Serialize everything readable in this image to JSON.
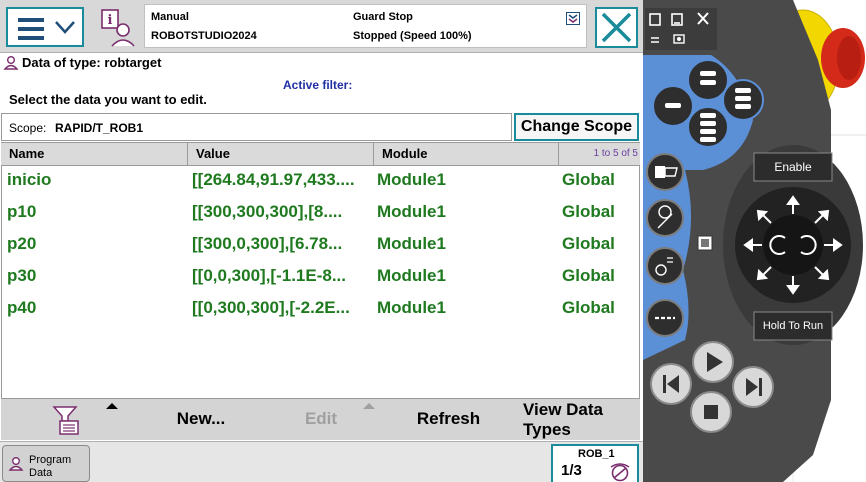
{
  "topbar": {
    "mode": "Manual",
    "controller": "ROBOTSTUDIO2024",
    "guard": "Guard Stop",
    "state": "Stopped (Speed 100%)"
  },
  "page": {
    "title": "Data of type: robtarget",
    "filter_label": "Active filter:",
    "instruction": "Select the data you want to edit.",
    "scope_label": "Scope:",
    "scope_value": "RAPID/T_ROB1",
    "change_scope": "Change Scope"
  },
  "table": {
    "headers": [
      "Name",
      "Value",
      "Module"
    ],
    "range": "1 to 5 of 5",
    "rows": [
      {
        "name": "inicio",
        "value": "[[264.84,91.97,433....",
        "module": "Module1",
        "scope": "Global"
      },
      {
        "name": "p10",
        "value": "[[300,300,300],[8....",
        "module": "Module1",
        "scope": "Global"
      },
      {
        "name": "p20",
        "value": "[[300,0,300],[6.78...",
        "module": "Module1",
        "scope": "Global"
      },
      {
        "name": "p30",
        "value": "[[0,0,300],[-1.1E-8...",
        "module": "Module1",
        "scope": "Global"
      },
      {
        "name": "p40",
        "value": "[[0,300,300],[-2.2E...",
        "module": "Module1",
        "scope": "Global"
      }
    ]
  },
  "toolbar": {
    "new_label": "New...",
    "edit_label": "Edit",
    "refresh_label": "Refresh",
    "view_line1": "View Data",
    "view_line2": "Types"
  },
  "taskbar": {
    "program_data_line1": "Program",
    "program_data_line2": "Data",
    "rob_label": "ROB_1",
    "rob_fraction": "1/3"
  },
  "pendant": {
    "enable_label": "Enable",
    "hold_label": "Hold To Run"
  },
  "colors": {
    "accent": "#1a8b9a",
    "data_text": "#1f7a1f",
    "filter_text": "#1f2ea3",
    "pendant_body": "#4a4a4a",
    "pendant_blue": "#5b8fd6",
    "emergency_red": "#d42a1a",
    "emergency_yellow": "#f2d800"
  },
  "icons": [
    "menu-icon",
    "chevron-down-icon",
    "operator-info-icon",
    "close-icon",
    "robtarget-icon",
    "program-data-icon",
    "filter-icon",
    "mechanical-unit-icon",
    "increment-icon"
  ]
}
